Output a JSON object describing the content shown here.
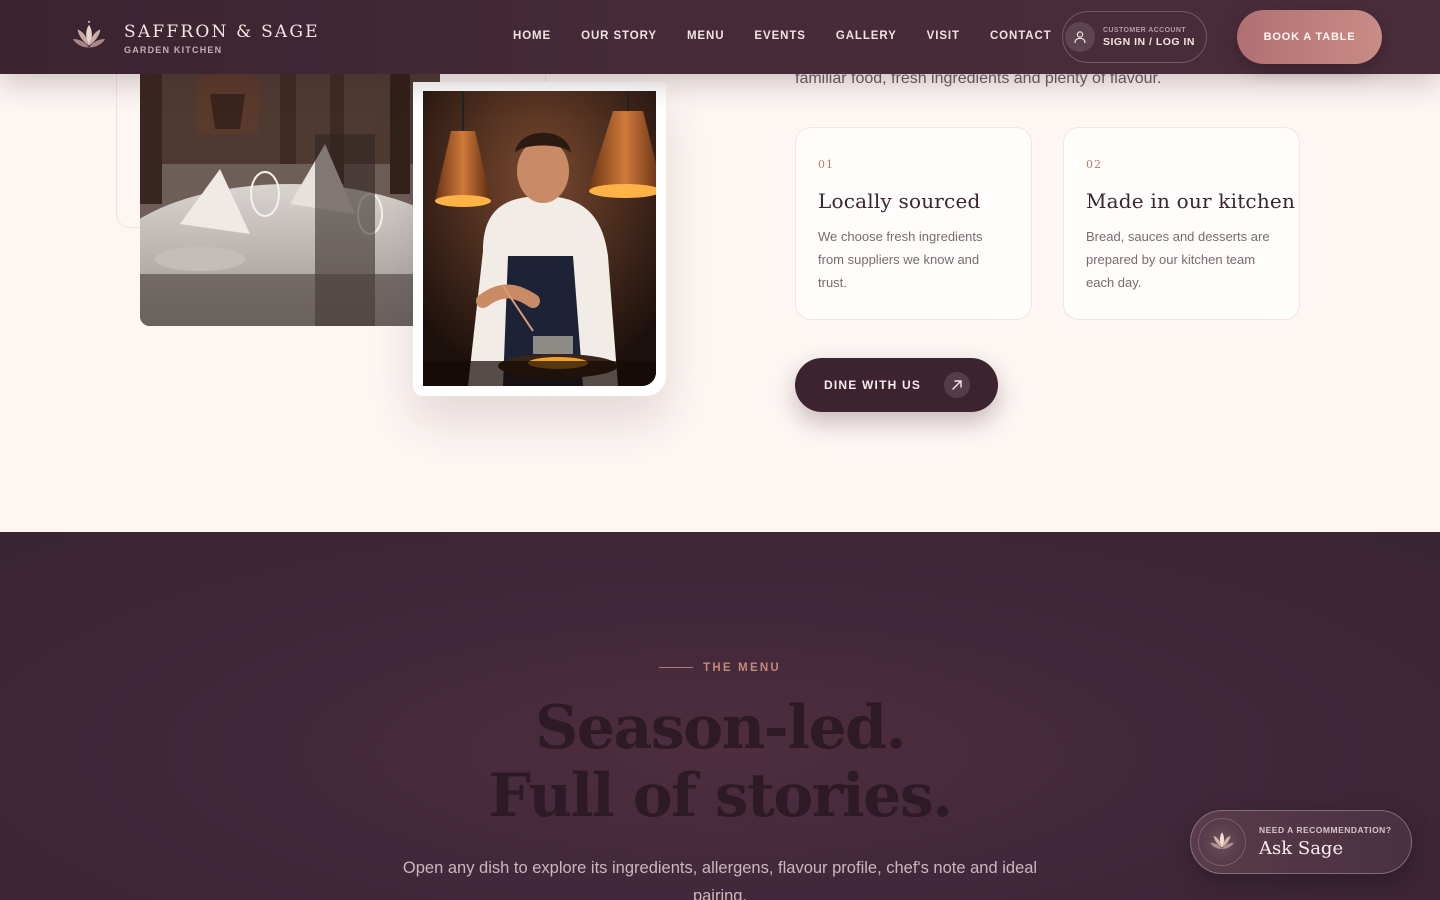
{
  "header": {
    "brand_name": "SAFFRON & SAGE",
    "brand_sub": "GARDEN KITCHEN",
    "nav": [
      "HOME",
      "OUR STORY",
      "MENU",
      "EVENTS",
      "GALLERY",
      "VISIT",
      "CONTACT"
    ],
    "account_small": "CUSTOMER ACCOUNT",
    "account_main": "SIGN IN / LOG IN",
    "book_label": "BOOK A TABLE"
  },
  "story": {
    "lead_text": "familiar food, fresh ingredients and plenty of flavour.",
    "features": [
      {
        "num": "01",
        "title": "Locally sourced",
        "body": "We choose fresh ingredients from suppliers we know and trust."
      },
      {
        "num": "02",
        "title": "Made in our kitchen",
        "body": "Bread, sauces and desserts are prepared by our kitchen team each day."
      }
    ],
    "dine_label": "DINE WITH US"
  },
  "menu": {
    "eyebrow": "THE MENU",
    "title_line1": "Season-led.",
    "title_line2": "Full of stories.",
    "description": "Open any dish to explore its ingredients, allergens, flavour profile, chef's note and ideal pairing."
  },
  "ask_sage": {
    "small": "NEED A RECOMMENDATION?",
    "main": "Ask Sage"
  },
  "icons": {
    "brand": "lotus-logo-icon",
    "account": "user-icon",
    "dine": "arrow-up-right-icon",
    "sage": "lotus-icon"
  },
  "colors": {
    "header_bg": "#3b2330",
    "accent": "#c98c86",
    "dark_plum": "#3d2330",
    "cream": "#fdf6f3"
  }
}
